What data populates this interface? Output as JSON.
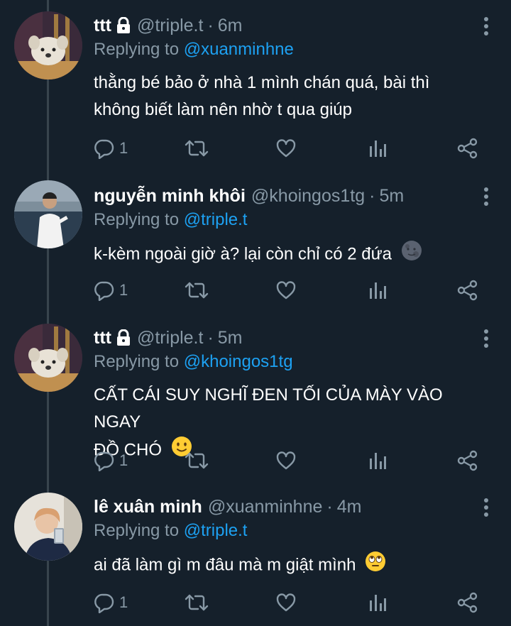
{
  "colors": {
    "background": "#15202b",
    "text": "#ffffff",
    "muted": "#8899a6",
    "link": "#1da1f2",
    "thread_line": "#38444d"
  },
  "tweets": [
    {
      "display_name": "ttt",
      "locked": true,
      "handle": "@triple.t",
      "separator": "·",
      "time": "6m",
      "replying_label": "Replying to",
      "replying_to": "@xuanminhne",
      "lines": [
        "thằng bé bảo ở nhà 1 mình chán quá, bài thì",
        "không biết làm nên nhờ t qua giúp"
      ],
      "emoji": "",
      "reply_count": "1",
      "avatar": "dog-plush-avatar"
    },
    {
      "display_name": "nguyễn minh khôi",
      "locked": false,
      "handle": "@khoingos1tg",
      "separator": "·",
      "time": "5m",
      "replying_label": "Replying to",
      "replying_to": "@triple.t",
      "lines": [
        "k-kèm ngoài giờ à? lại còn chỉ có 2 đứa"
      ],
      "emoji": "new-moon-face-emoji",
      "reply_count": "1",
      "avatar": "person-photo-avatar"
    },
    {
      "display_name": "ttt",
      "locked": true,
      "handle": "@triple.t",
      "separator": "·",
      "time": "5m",
      "replying_label": "Replying to",
      "replying_to": "@khoingos1tg",
      "lines": [
        "CẤT CÁI SUY NGHĨ ĐEN TỐI CỦA MÀY VÀO NGAY",
        "ĐỒ CHÓ"
      ],
      "emoji": "slightly-smiling-face-emoji",
      "reply_count": "1",
      "avatar": "dog-plush-avatar"
    },
    {
      "display_name": "lê xuân minh",
      "locked": false,
      "handle": "@xuanminhne",
      "separator": "·",
      "time": "4m",
      "replying_label": "Replying to",
      "replying_to": "@triple.t",
      "lines": [
        "ai đã làm gì m đâu mà m giật mình"
      ],
      "emoji": "eye-roll-emoji",
      "reply_count": "1",
      "avatar": "selfie-photo-avatar"
    }
  ],
  "icons": {
    "lock": "lock-icon",
    "more": "more-vertical-icon",
    "reply": "reply-bubble-icon",
    "retweet": "retweet-icon",
    "like": "heart-icon",
    "analytics": "analytics-bars-icon",
    "share": "share-icon"
  }
}
